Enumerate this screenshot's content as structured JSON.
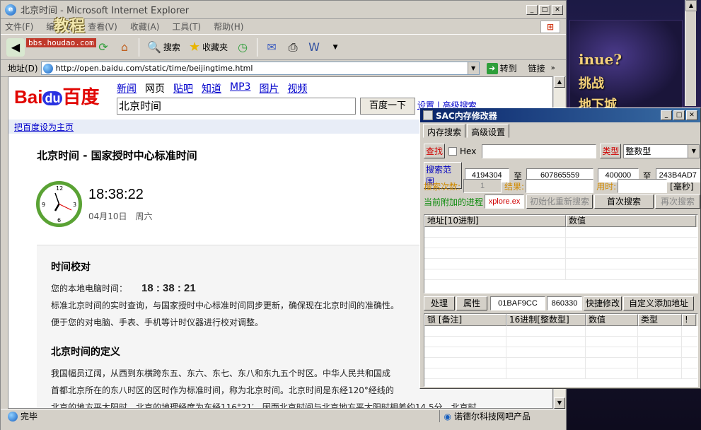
{
  "desktop": {
    "bg_text_1": "inue?",
    "bg_text_2": "挑战",
    "bg_text_3": "地下城"
  },
  "ie": {
    "title": "北京时间 - Microsoft Internet Explorer",
    "logo_overlay": {
      "cn": "教程",
      "url": "bbs.houdao.com"
    },
    "menu": [
      "文件(F)",
      "编辑(E)",
      "查看(V)",
      "收藏(A)",
      "工具(T)",
      "帮助(H)"
    ],
    "toolbar": {
      "search": "搜索",
      "favorites": "收藏夹"
    },
    "address_label": "地址(D)",
    "address": "http://open.baidu.com/static/time/beijingtime.html",
    "go": "转到",
    "links": "链接",
    "status": {
      "text": "完毕",
      "zone": "诺德尔科技网吧产品"
    }
  },
  "baidu": {
    "nav": [
      "新闻",
      "网页",
      "贴吧",
      "知道",
      "MP3",
      "图片",
      "视频"
    ],
    "search_value": "北京时间",
    "search_btn": "百度一下",
    "settings": "设置 | 高级搜索",
    "set_home": "把百度设为主页"
  },
  "page": {
    "title": "北京时间  - 国家授时中心标准时间",
    "time": "18:38:22",
    "date": "04月10日",
    "weekday": "周六",
    "clock_numbers": {
      "n12": "12",
      "n3": "3",
      "n6": "6",
      "n9": "9"
    },
    "section1_title": "时间校对",
    "local_label": "您的本地电脑时间：",
    "local_time": "18 : 38 : 21",
    "para1_line1": "标准北京时间的实时查询，与国家授时中心标准时间同步更新，确保现在北京时间的准确性。",
    "para1_line2": "便于您的对电脑、手表、手机等计时仪器进行校对调整。",
    "section2_title": "北京时间的定义",
    "para2_line1": "我国幅员辽阔，从西到东横跨东五、东六、东七、东八和东九五个时区。中华人民共和国成",
    "para2_line2": "首都北京所在的东八时区的区时作为标准时间，称为北京时间。北京时间是东经120°经线的",
    "para2_line3": "北京的地方平太阳时。北京的地理经度为东经116°21′，因而北京时间与北京地方平太阳时相差约14.5分。北京时"
  },
  "sac": {
    "title": "SAC内存修改器",
    "tabs": [
      "内存搜索",
      "高级设置"
    ],
    "find_label": "查找",
    "hex_label": "Hex",
    "type_label": "类型",
    "type_value": "整数型",
    "range_label": "搜索范围",
    "range_start": "4194304",
    "to1": "至",
    "range_end": "607865559",
    "range2_start": "400000",
    "to2": "至",
    "range2_end": "243B4AD7",
    "count_label": "搜索次数:",
    "count_value": "1",
    "result_label": "结果:",
    "time_label": "用时:",
    "ms_label": "[毫秒]",
    "process_label": "当前附加的进程",
    "process_value": "xplore.ex",
    "init_btn": "初始化重新搜索",
    "first_btn": "首次搜索",
    "again_btn": "再次搜索",
    "grid1_cols": [
      "地址[10进制]",
      "数值"
    ],
    "handle_btn": "处理",
    "attr_btn": "属性",
    "addr_value": "01BAF9CC",
    "val_value": "860330",
    "quick_btn": "快捷修改",
    "custom_btn": "自定义添加地址",
    "grid2_cols": [
      "锁 [备注]",
      "16进制[整数型]",
      "数值",
      "类型",
      "!"
    ]
  }
}
